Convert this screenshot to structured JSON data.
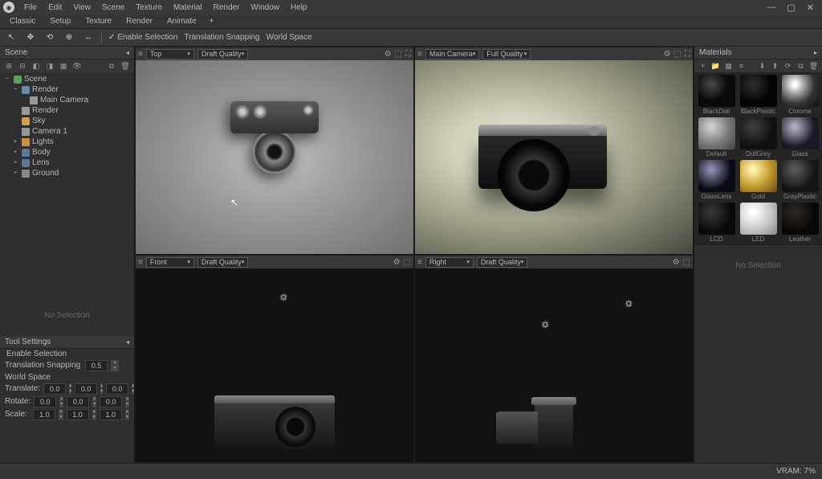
{
  "menu": {
    "items": [
      "File",
      "Edit",
      "View",
      "Scene",
      "Texture",
      "Material",
      "Render",
      "Window",
      "Help"
    ]
  },
  "subtabs": {
    "items": [
      "Classic",
      "Setup",
      "Texture",
      "Render",
      "Animate"
    ]
  },
  "toolbar": {
    "enable_selection": "Enable Selection",
    "translation_snapping": "Translation Snapping",
    "world_space": "World Space"
  },
  "scene_panel": {
    "title": "Scene",
    "no_selection": "No Selection"
  },
  "scene_tree": [
    {
      "label": "Scene",
      "icon": "ic-scene",
      "indent": 0,
      "toggle": "−"
    },
    {
      "label": "Render",
      "icon": "ic-render",
      "indent": 1,
      "toggle": "−"
    },
    {
      "label": "Main Camera",
      "icon": "ic-cam",
      "indent": 2,
      "toggle": ""
    },
    {
      "label": "Render",
      "icon": "ic-cam",
      "indent": 1,
      "toggle": ""
    },
    {
      "label": "Sky",
      "icon": "ic-sky",
      "indent": 1,
      "toggle": ""
    },
    {
      "label": "Camera 1",
      "icon": "ic-cam",
      "indent": 1,
      "toggle": ""
    },
    {
      "label": "Lights",
      "icon": "ic-folder",
      "indent": 1,
      "toggle": "+"
    },
    {
      "label": "Body",
      "icon": "ic-geo",
      "indent": 1,
      "toggle": "+"
    },
    {
      "label": "Lens",
      "icon": "ic-geo",
      "indent": 1,
      "toggle": "+"
    },
    {
      "label": "Ground",
      "icon": "ic-ground",
      "indent": 1,
      "toggle": "+"
    }
  ],
  "tool_settings": {
    "title": "Tool Settings",
    "enable_selection": "Enable Selection",
    "translation_snapping": "Translation Snapping",
    "translation_snapping_val": "0.5",
    "world_space": "World Space",
    "translate_label": "Translate:",
    "rotate_label": "Rotate:",
    "scale_label": "Scale:",
    "translate": [
      "0.0",
      "0.0",
      "0.0"
    ],
    "rotate": [
      "0.0",
      "0.0",
      "0.0"
    ],
    "scale": [
      "1.0",
      "1.0",
      "1.0"
    ]
  },
  "viewports": {
    "tl": {
      "view": "Top",
      "quality": "Draft Quality"
    },
    "tr": {
      "view": "Main Camera",
      "quality": "Full Quality"
    },
    "bl": {
      "view": "Front",
      "quality": "Draft Quality"
    },
    "br": {
      "view": "Right",
      "quality": "Draft Quality"
    }
  },
  "materials_panel": {
    "title": "Materials",
    "no_selection": "No Selection"
  },
  "materials": [
    {
      "name": "BlackDial",
      "swatch": "sw-blackdial"
    },
    {
      "name": "BlackPlastic",
      "swatch": "sw-blackplastic"
    },
    {
      "name": "Chrome",
      "swatch": "sw-chrome"
    },
    {
      "name": "Default",
      "swatch": "sw-default"
    },
    {
      "name": "DullGrey",
      "swatch": "sw-dullgrey"
    },
    {
      "name": "Glass",
      "swatch": "sw-glass"
    },
    {
      "name": "GlassLens",
      "swatch": "sw-glasslens"
    },
    {
      "name": "Gold",
      "swatch": "sw-gold"
    },
    {
      "name": "GrayPlastic",
      "swatch": "sw-grayplastic"
    },
    {
      "name": "LCD",
      "swatch": "sw-lcd"
    },
    {
      "name": "LED",
      "swatch": "sw-led"
    },
    {
      "name": "Leather",
      "swatch": "sw-leather"
    }
  ],
  "status": {
    "vram": "VRAM: 7%"
  }
}
